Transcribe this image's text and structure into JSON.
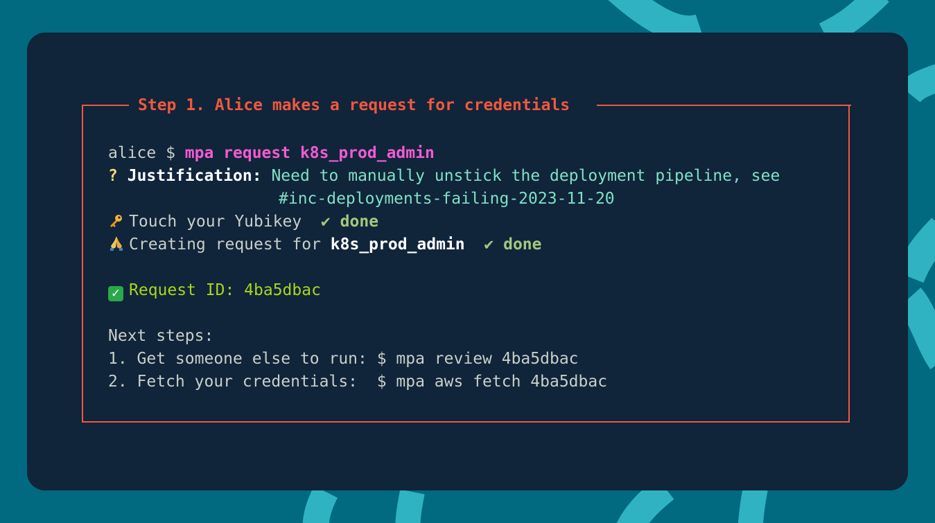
{
  "colors": {
    "background": "#016a81",
    "terminal_bg": "#10243a",
    "accent_red": "#f0583e",
    "command_pink": "#f25bd2",
    "answer_teal": "#7fe2c4",
    "done_green": "#a5c77d",
    "success_green": "#a8d61f"
  },
  "frame": {
    "title": "Step 1. Alice makes a request for credentials"
  },
  "terminal": {
    "prompt": "alice $ ",
    "command": "mpa request k8s_prod_admin",
    "question_mark": "?",
    "justification_label": "Justification:",
    "justification_line1": "Need to manually unstick the deployment pipeline, see",
    "justification_line2": "#inc-deployments-failing-2023-11-20",
    "touch_icon": "key-icon",
    "touch_text": "Touch your Yubikey",
    "touch_check": "✔",
    "touch_status": "done",
    "creating_icon": "folded-hands-icon",
    "creating_text": "Creating request for ",
    "creating_target": "k8s_prod_admin",
    "creating_check": "✔",
    "creating_status": "done",
    "request_icon": "check-box-icon",
    "request_id_text": "Request ID: 4ba5dbac",
    "next_steps_heading": "Next steps:",
    "next_step_1": "1. Get someone else to run: $ mpa review 4ba5dbac",
    "next_step_2": "2. Fetch your credentials:  $ mpa aws fetch 4ba5dbac"
  }
}
